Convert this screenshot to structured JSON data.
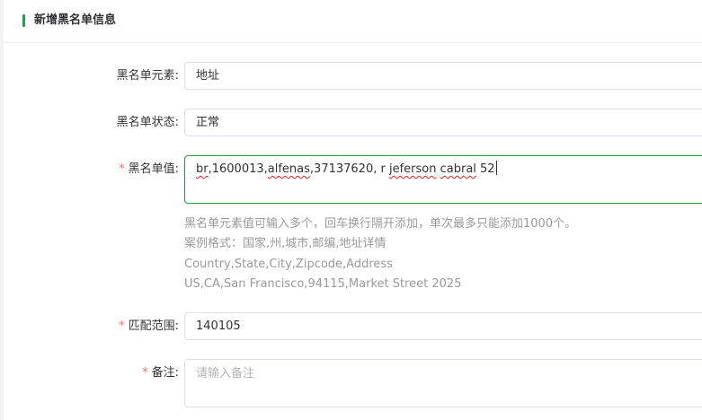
{
  "header": {
    "title": "新增黑名单信息"
  },
  "form": {
    "element": {
      "label": "黑名单元素:",
      "value": "地址"
    },
    "status": {
      "label": "黑名单状态:",
      "value": "正常"
    },
    "value_field": {
      "required_mark": "*",
      "label": "黑名单值:",
      "segments": [
        "br",
        ",1600013,",
        "alfenas",
        ",37137620, r ",
        "jeferson",
        " ",
        "cabral",
        " 52"
      ],
      "hint_lines": [
        "黑名单元素值可输入多个，回车换行隔开添加，单次最多只能添加1000个。",
        "案例格式：国家,州,城市,邮编,地址详情",
        "Country,State,City,Zipcode,Address",
        "US,CA,San Francisco,94115,Market Street 2025"
      ]
    },
    "match_range": {
      "required_mark": "*",
      "label": "匹配范围:",
      "value": "140105"
    },
    "remark": {
      "required_mark": "*",
      "label": "备注:",
      "placeholder": "请输入备注"
    }
  },
  "colors": {
    "accent": "#1aa34a",
    "required": "#f56c6c",
    "spellcheck": "#e02020"
  }
}
